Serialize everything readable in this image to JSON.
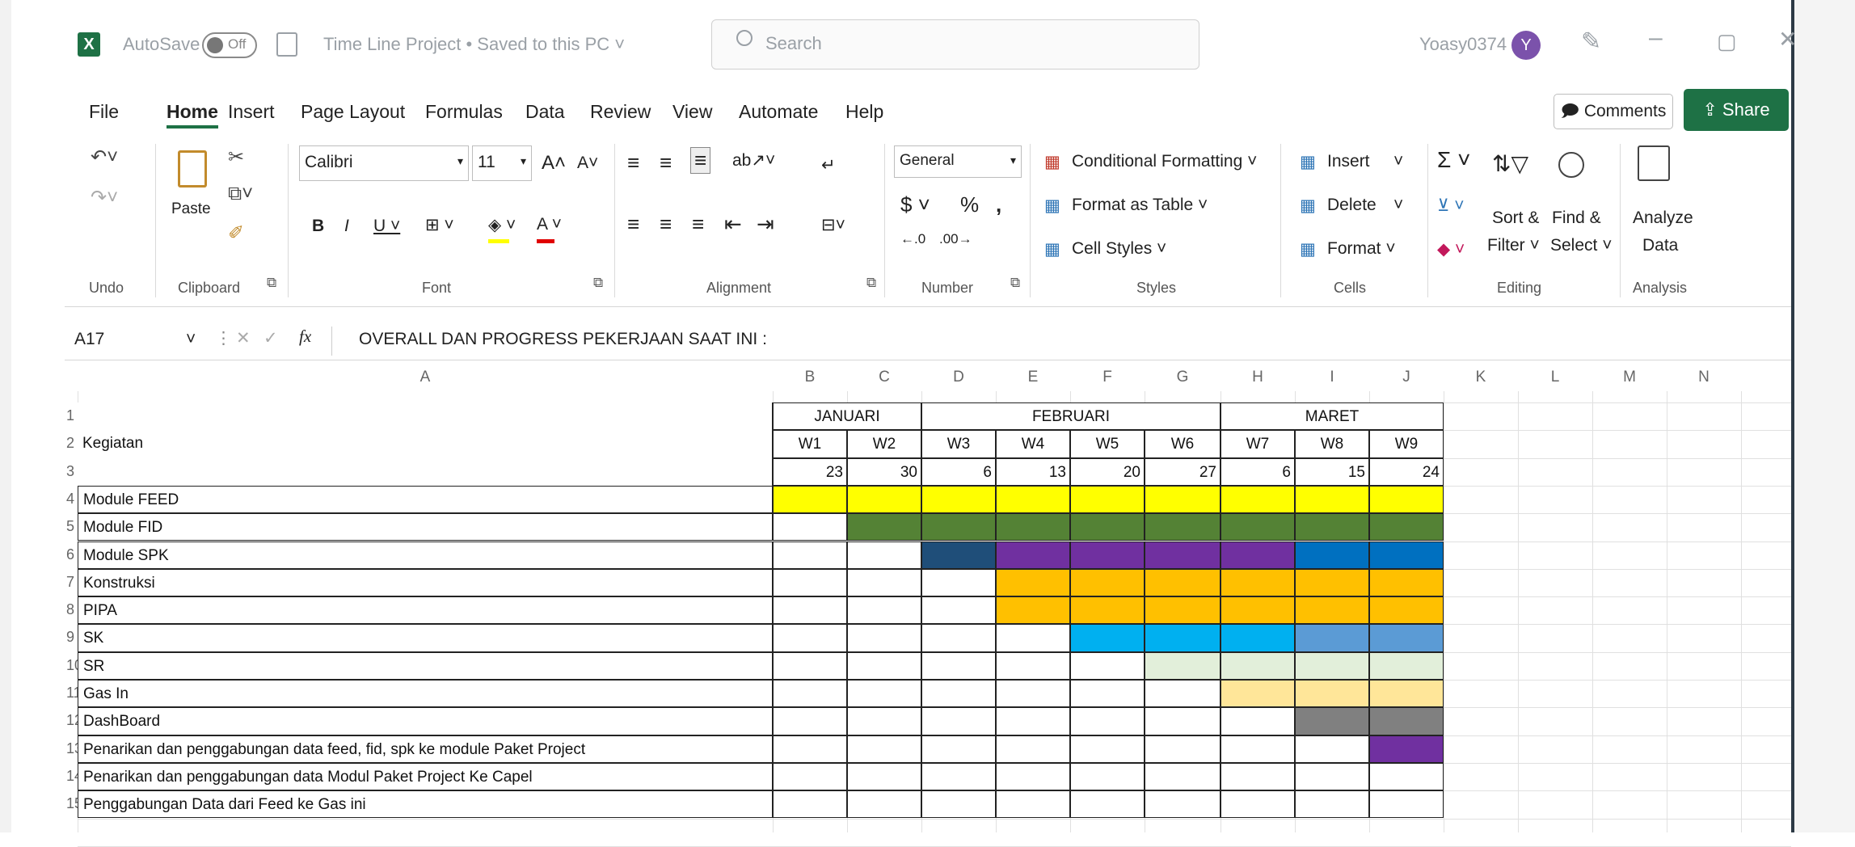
{
  "titlebar": {
    "autosave_label": "AutoSave",
    "autosave_state": "Off",
    "doc_title": "Time Line Project • Saved to this PC ˅",
    "search_placeholder": "Search",
    "user_name": "Yoasy0374",
    "avatar_letter": "Y"
  },
  "tabs": [
    "File",
    "Home",
    "Insert",
    "Page Layout",
    "Formulas",
    "Data",
    "Review",
    "View",
    "Automate",
    "Help"
  ],
  "active_tab": "Home",
  "buttons": {
    "comments": "Comments",
    "share": "Share"
  },
  "ribbon": {
    "undo_group": "Undo",
    "clipboard_group": "Clipboard",
    "paste_label": "Paste",
    "font_group": "Font",
    "font_name": "Calibri",
    "font_size": "11",
    "alignment_group": "Alignment",
    "number_group": "Number",
    "number_format": "General",
    "styles_group": "Styles",
    "conditional_formatting": "Conditional Formatting ˅",
    "format_as_table": "Format as Table ˅",
    "cell_styles": "Cell Styles ˅",
    "cells_group": "Cells",
    "insert": "Insert",
    "delete": "Delete",
    "format": "Format ˅",
    "editing_group": "Editing",
    "sort_filter_1": "Sort &",
    "sort_filter_2": "Filter ˅",
    "find_select_1": "Find &",
    "find_select_2": "Select ˅",
    "analysis_group": "Analysis",
    "analyze_1": "Analyze",
    "analyze_2": "Data"
  },
  "formula_bar": {
    "name_box": "A17",
    "fx": "fx",
    "formula": "OVERALL DAN PROGRESS PEKERJAAN SAAT INI :"
  },
  "columns": [
    "A",
    "B",
    "C",
    "D",
    "E",
    "F",
    "G",
    "H",
    "I",
    "J",
    "K",
    "L",
    "M",
    "N"
  ],
  "months": [
    "JANUARI",
    "FEBRUARI",
    "MARET"
  ],
  "kegiatan_header": "Kegiatan",
  "weeks": [
    "W1",
    "W2",
    "W3",
    "W4",
    "W5",
    "W6",
    "W7",
    "W8",
    "W9"
  ],
  "dates": [
    "23",
    "30",
    "6",
    "13",
    "20",
    "27",
    "6",
    "15",
    "24"
  ],
  "row_numbers": [
    "1",
    "2",
    "3",
    "4",
    "5",
    "6",
    "7",
    "8",
    "9",
    "10",
    "11",
    "12",
    "13",
    "14",
    "15"
  ],
  "tasks": [
    {
      "name": "Module FEED",
      "fills": [
        "#ffff00",
        "#ffff00",
        "#ffff00",
        "#ffff00",
        "#ffff00",
        "#ffff00",
        "#ffff00",
        "#ffff00",
        "#ffff00"
      ]
    },
    {
      "name": "Module FID",
      "fills": [
        "",
        "#548235",
        "#548235",
        "#548235",
        "#548235",
        "#548235",
        "#548235",
        "#548235",
        "#548235"
      ]
    },
    {
      "name": "Module SPK",
      "fills": [
        "",
        "",
        "#1f4e79",
        "#7030a0",
        "#7030a0",
        "#7030a0",
        "#7030a0",
        "#0070c0",
        "#0070c0"
      ]
    },
    {
      "name": "Konstruksi",
      "fills": [
        "",
        "",
        "",
        "#ffc000",
        "#ffc000",
        "#ffc000",
        "#ffc000",
        "#ffc000",
        "#ffc000"
      ]
    },
    {
      "name": "PIPA",
      "fills": [
        "",
        "",
        "",
        "#ffc000",
        "#ffc000",
        "#ffc000",
        "#ffc000",
        "#ffc000",
        "#ffc000"
      ]
    },
    {
      "name": "SK",
      "fills": [
        "",
        "",
        "",
        "",
        "#00b0f0",
        "#00b0f0",
        "#00b0f0",
        "#5b9bd5",
        "#5b9bd5"
      ]
    },
    {
      "name": "SR",
      "fills": [
        "",
        "",
        "",
        "",
        "",
        "#e2efda",
        "#e2efda",
        "#e2efda",
        "#e2efda"
      ]
    },
    {
      "name": "Gas In",
      "fills": [
        "",
        "",
        "",
        "",
        "",
        "",
        "#ffe699",
        "#ffe699",
        "#ffe699"
      ]
    },
    {
      "name": "DashBoard",
      "fills": [
        "",
        "",
        "",
        "",
        "",
        "",
        "",
        "#808080",
        "#808080"
      ]
    },
    {
      "name": "Penarikan dan penggabungan data feed, fid, spk ke module Paket Project",
      "fills": [
        "",
        "",
        "",
        "",
        "",
        "",
        "",
        "",
        "#7030a0"
      ]
    },
    {
      "name": "Penarikan dan penggabungan data Modul Paket Project Ke Capel",
      "fills": [
        "",
        "",
        "",
        "",
        "",
        "",
        "",
        "",
        ""
      ]
    },
    {
      "name": "Penggabungan Data dari Feed ke Gas ini",
      "fills": [
        "",
        "",
        "",
        "",
        "",
        "",
        "",
        "",
        ""
      ]
    }
  ]
}
